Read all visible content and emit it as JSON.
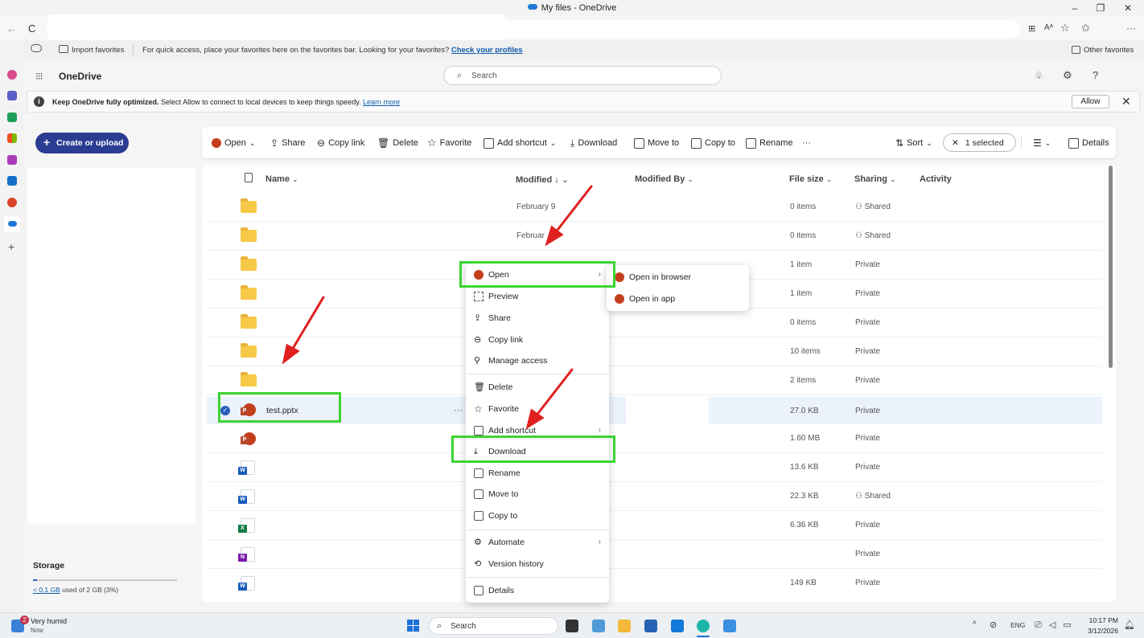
{
  "window": {
    "title": "My files - OneDrive"
  },
  "favorites": {
    "import_label": "Import favorites",
    "message": "For quick access, place your favorites here on the favorites bar. Looking for your favorites?",
    "link": "Check your profiles",
    "other": "Other favorites"
  },
  "app": {
    "name": "OneDrive",
    "search_placeholder": "Search"
  },
  "notice": {
    "bold": "Keep OneDrive fully optimized.",
    "text": "Select Allow to connect to local devices to keep things speedy.",
    "link": "Learn more",
    "allow": "Allow"
  },
  "create_label": "Create or upload",
  "storage": {
    "title": "Storage",
    "used_link": "< 0.1 GB",
    "text": "used of 2 GB (3%)",
    "fraction": 0.03
  },
  "toolbar": {
    "open": "Open",
    "share": "Share",
    "copy_link": "Copy link",
    "delete": "Delete",
    "favorite": "Favorite",
    "add_shortcut": "Add shortcut",
    "download": "Download",
    "move_to": "Move to",
    "copy_to": "Copy to",
    "rename": "Rename",
    "more": "···",
    "sort": "Sort",
    "selected": "1 selected",
    "details": "Details"
  },
  "columns": {
    "name": "Name",
    "modified": "Modified",
    "modified_by": "Modified By",
    "size": "File size",
    "sharing": "Sharing",
    "activity": "Activity"
  },
  "rows": [
    {
      "modified": "February 9",
      "size": "0 items",
      "sharing": "Shared"
    },
    {
      "modified": "Februar",
      "size": "0 items",
      "sharing": "Shared"
    },
    {
      "modified": "",
      "size": "1 item",
      "sharing": "Private"
    },
    {
      "modified": "",
      "size": "1 item",
      "sharing": "Private"
    },
    {
      "modified": "",
      "size": "0 items",
      "sharing": "Private"
    },
    {
      "modified": "",
      "size": "10 items",
      "sharing": "Private"
    },
    {
      "modified": "",
      "size": "2 items",
      "sharing": "Private"
    },
    {
      "name": "test.pptx",
      "size": "27.0 KB",
      "sharing": "Private"
    },
    {
      "size": "1.60 MB",
      "sharing": "Private"
    },
    {
      "size": "13.6 KB",
      "sharing": "Private"
    },
    {
      "size": "22.3 KB",
      "sharing": "Shared"
    },
    {
      "size": "6.36 KB",
      "sharing": "Private"
    },
    {
      "size": "",
      "sharing": "Private"
    },
    {
      "size": "149 KB",
      "sharing": "Private"
    }
  ],
  "row_more": "···",
  "context_menu": {
    "open": "Open",
    "preview": "Preview",
    "share": "Share",
    "copy_link": "Copy link",
    "manage_access": "Manage access",
    "delete": "Delete",
    "favorite": "Favorite",
    "add_shortcut": "Add shortcut",
    "download": "Download",
    "rename": "Rename",
    "move_to": "Move to",
    "copy_to": "Copy to",
    "automate": "Automate",
    "version_history": "Version history",
    "details": "Details"
  },
  "submenu": {
    "open_browser": "Open in browser",
    "open_app": "Open in app"
  },
  "taskbar": {
    "weather": "Very humid",
    "weather_sub": "Now",
    "badge": "2",
    "search": "Search",
    "lang": "ENG",
    "time": "10:17 PM",
    "date": "3/12/2026"
  },
  "colors": {
    "accent": "#2b3d92",
    "highlight": "#3bd433",
    "arrow": "#e02020"
  }
}
